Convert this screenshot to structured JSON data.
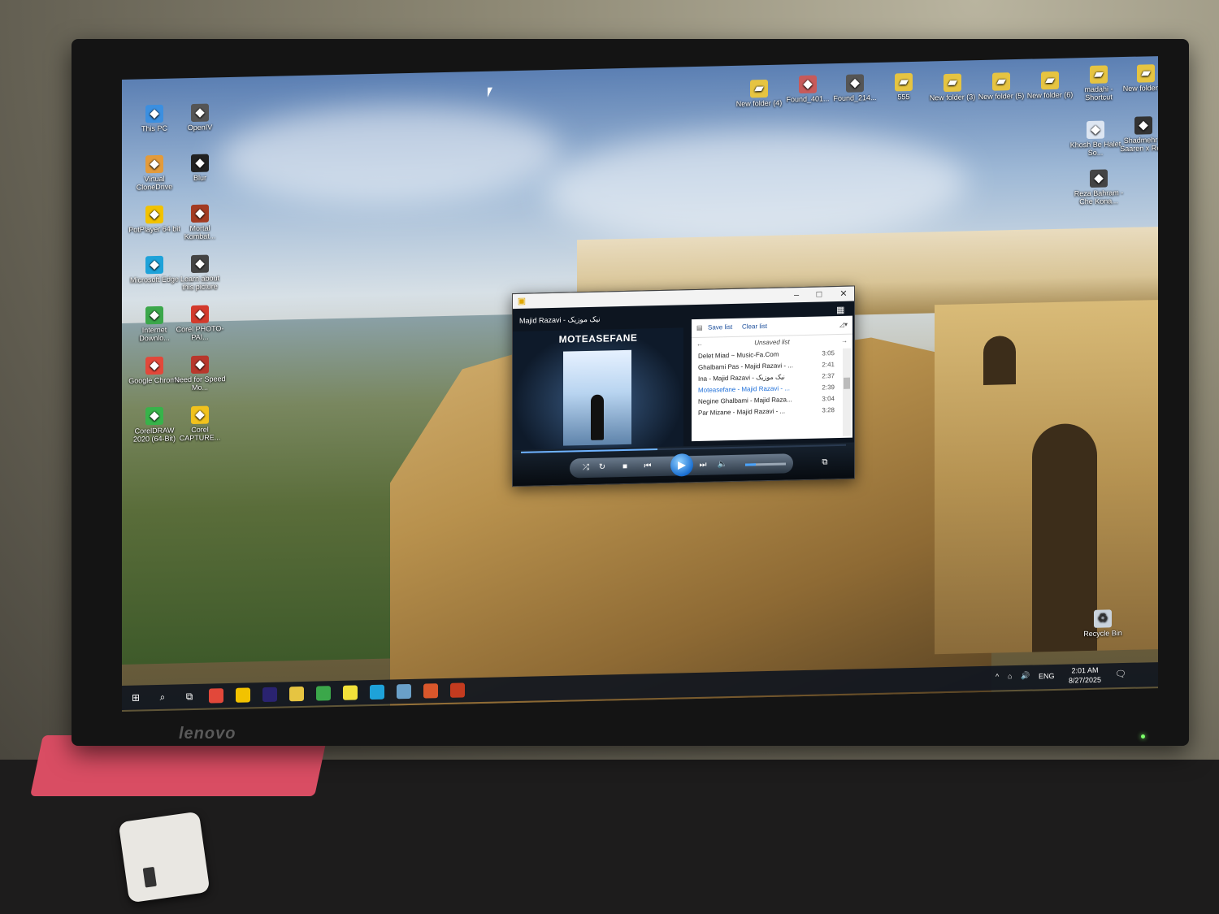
{
  "monitor": {
    "brand": "lenovo"
  },
  "desktop_icons_left": [
    {
      "label": "This PC",
      "icon": "computer-icon",
      "color": "#3b8fe0"
    },
    {
      "label": "OpenIV",
      "icon": "openiv-icon",
      "color": "#555555"
    },
    {
      "label": "Virtual CloneDrive",
      "icon": "sheep-icon",
      "color": "#e39b3b"
    },
    {
      "label": "Blur",
      "icon": "blur-icon",
      "color": "#222222"
    },
    {
      "label": "PotPlayer 64 bit",
      "icon": "potplayer-icon",
      "color": "#f2c200"
    },
    {
      "label": "Mortal Kombat...",
      "icon": "game-icon",
      "color": "#a33b22"
    },
    {
      "label": "Microsoft Edge",
      "icon": "edge-icon",
      "color": "#1ea2d9"
    },
    {
      "label": "Learn about this picture",
      "icon": "camera-icon",
      "color": "#444444"
    },
    {
      "label": "Internet Downlo...",
      "icon": "idm-icon",
      "color": "#3ba74a"
    },
    {
      "label": "Corel PHOTO-PAI...",
      "icon": "corel-photo-icon",
      "color": "#d33a2c"
    },
    {
      "label": "Google Chrome",
      "icon": "chrome-icon",
      "color": "#e2483a"
    },
    {
      "label": "Need for Speed Mo...",
      "icon": "nfs-icon",
      "color": "#b8372c"
    },
    {
      "label": "CorelDRAW 2020 (64-Bit)",
      "icon": "coreldraw-icon",
      "color": "#37b34a"
    },
    {
      "label": "Corel CAPTURE...",
      "icon": "corel-capture-icon",
      "color": "#f1c21d"
    }
  ],
  "desktop_icons_right": [
    {
      "label": "New folder (4)",
      "icon": "folder-icon",
      "color": "#e6c441"
    },
    {
      "label": "Found_401...",
      "icon": "image-icon",
      "color": "#c75a5a"
    },
    {
      "label": "Found_214...",
      "icon": "image-icon",
      "color": "#555555"
    },
    {
      "label": "555",
      "icon": "folder-icon",
      "color": "#e6c441"
    },
    {
      "label": "New folder (3)",
      "icon": "folder-icon",
      "color": "#e6c441"
    },
    {
      "label": "New folder (5)",
      "icon": "folder-icon",
      "color": "#e6c441"
    },
    {
      "label": "New folder (6)",
      "icon": "folder-icon",
      "color": "#e6c441"
    },
    {
      "label": "madahi - Shortcut",
      "icon": "folder-shortcut-icon",
      "color": "#e6c441"
    },
    {
      "label": "New folder (2)",
      "icon": "folder-icon",
      "color": "#e6c441"
    },
    {
      "label": "Khosh Be Halet So...",
      "icon": "mp3-icon",
      "color": "#dde6f2"
    },
    {
      "label": "Shadmehr x Saaren x Re...",
      "icon": "image-icon",
      "color": "#333333"
    },
    {
      "label": "Reza Bahram - Che Kona...",
      "icon": "image-icon",
      "color": "#444444"
    }
  ],
  "recycle_bin": {
    "label": "Recycle Bin",
    "icon": "recycle-bin-icon"
  },
  "player": {
    "now_playing": "Majid Razavi - نیک موزیک",
    "album_title": "MOTEASEFANE",
    "save_list": "Save list",
    "clear_list": "Clear list",
    "list_name": "Unsaved list",
    "progress": 0.42,
    "volume": 0.25,
    "tracks": [
      {
        "title": "Delet Miad ~ Music-Fa.Com",
        "duration": "3:05",
        "active": false
      },
      {
        "title": "Ghalbami Pas - Majid Razavi - ...",
        "duration": "2:41",
        "active": false
      },
      {
        "title": "Ina - Majid Razavi - نیک موزیک",
        "duration": "2:37",
        "active": false
      },
      {
        "title": "Moteasefane - Majid Razavi - ...",
        "duration": "2:39",
        "active": true
      },
      {
        "title": "Negine Ghalbami - Majid Raza...",
        "duration": "3:04",
        "active": false
      },
      {
        "title": "Par Mizane - Majid Razavi - ...",
        "duration": "3:28",
        "active": false
      }
    ]
  },
  "taskbar": {
    "items": [
      {
        "icon": "start-icon",
        "color": "#ffffff"
      },
      {
        "icon": "search-icon",
        "color": "#ffffff"
      },
      {
        "icon": "task-view-icon",
        "color": "#ffffff"
      },
      {
        "icon": "chrome-icon",
        "color": "#e2483a"
      },
      {
        "icon": "media-player-icon",
        "color": "#f2c200"
      },
      {
        "icon": "premiere-icon",
        "color": "#2a2370"
      },
      {
        "icon": "file-explorer-icon",
        "color": "#e6c441"
      },
      {
        "icon": "idm-icon",
        "color": "#3ba74a"
      },
      {
        "icon": "sticky-notes-icon",
        "color": "#f2e13a"
      },
      {
        "icon": "edge-icon",
        "color": "#1ea2d9"
      },
      {
        "icon": "app-icon",
        "color": "#6aa0c8"
      },
      {
        "icon": "game-icon",
        "color": "#d9572b"
      },
      {
        "icon": "game-icon",
        "color": "#c43b1f"
      }
    ],
    "language": "ENG",
    "time": "2:01 AM",
    "date": "8/27/2025"
  }
}
